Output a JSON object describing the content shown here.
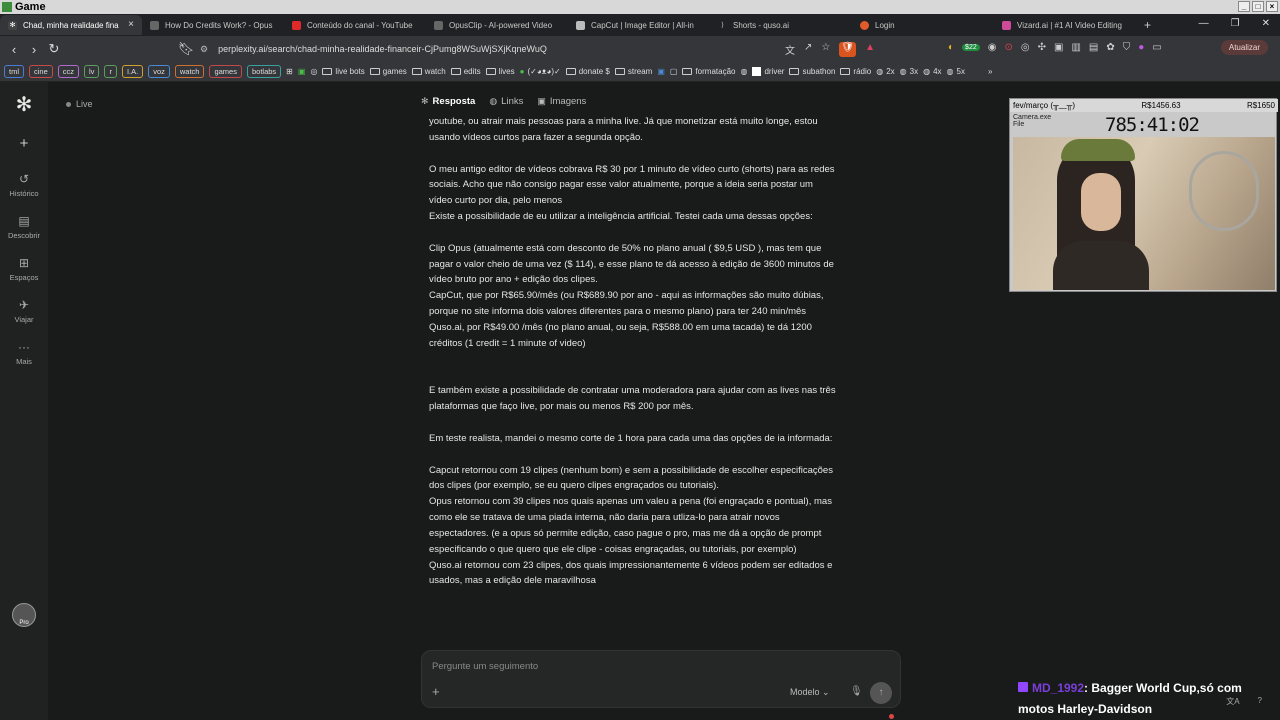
{
  "window": {
    "title": "Game"
  },
  "tabs": [
    {
      "label": "Chad, minha realidade fina",
      "active": true,
      "icon": "perplexity-icon"
    },
    {
      "label": "How Do Credits Work? - Opus",
      "icon": "opus-icon"
    },
    {
      "label": "Conteúdo do canal - YouTube",
      "icon": "youtube-icon"
    },
    {
      "label": "OpusClip - AI-powered Video",
      "icon": "opus-icon"
    },
    {
      "label": "CapCut | Image Editor | All-in",
      "icon": "capcut-icon"
    },
    {
      "label": "Shorts - quso.ai",
      "icon": "quso-icon"
    },
    {
      "label": "Login",
      "icon": "s-icon"
    },
    {
      "label": "Vizard.ai | #1 AI Video Editing",
      "icon": "vizard-icon"
    }
  ],
  "addressbar": {
    "url": "perplexity.ai/search/chad-minha-realidade-financeir-CjPumg8WSuWjSXjKqneWuQ",
    "update_label": "Atualizar",
    "badge": "$22"
  },
  "bookmarks": [
    "tml",
    "cine",
    "ccz",
    "lv",
    "r",
    "I.A.",
    "voz",
    "watch",
    "games",
    "botlabs",
    "live bots",
    "games",
    "watch",
    "edits",
    "lives",
    "(✓◕ᴥ◕)✓",
    "donate $",
    "stream",
    "formatação",
    "driver",
    "subathon",
    "rádio",
    "2x",
    "3x",
    "4x",
    "5x"
  ],
  "sidebar": {
    "items": [
      {
        "label": "Histórico",
        "icon": "history-icon"
      },
      {
        "label": "Descobrir",
        "icon": "discover-icon"
      },
      {
        "label": "Espaços",
        "icon": "spaces-icon"
      },
      {
        "label": "Viajar",
        "icon": "travel-icon"
      },
      {
        "label": "Mais",
        "icon": "more-icon"
      }
    ],
    "avatar_label": "Pro"
  },
  "header": {
    "live_label": "Live",
    "tabs": [
      "Resposta",
      "Links",
      "Imagens"
    ]
  },
  "content": {
    "lines": [
      "youtube, ou atrair mais pessoas para a minha live. Já que monetizar está muito longe, estou",
      "usando vídeos curtos para fazer a segunda opção.",
      "",
      "O meu antigo editor de vídeos cobrava R$ 30 por 1 minuto de vídeo curto (shorts) para as redes",
      "sociais. Acho que não consigo pagar esse valor atualmente, porque a ideia seria postar um",
      "vídeo curto por dia, pelo menos",
      "Existe a possibilidade de eu utilizar a inteligência artificial. Testei cada uma dessas opções:",
      "",
      "Clip Opus (atualmente está com desconto de 50% no plano anual ( $9,5 USD ), mas tem que",
      "pagar o valor cheio de uma vez ($ 114), e esse plano te dá acesso à edição de 3600 minutos de",
      "vídeo bruto por ano + edição dos clipes.",
      "CapCut, que por R$65.90/mês (ou R$689.90 por ano - aqui as informações são muito dúbias,",
      "porque no site informa dois valores diferentes para o mesmo plano) para ter 240 min/mês",
      "Quso.ai, por R$49.00 /mês (no plano anual, ou seja, R$588.00 em uma tacada) te dá 1200",
      "créditos (1 credit = 1 minute of video)",
      "",
      "",
      "E também existe a possibilidade de contratar uma moderadora para ajudar com as lives nas três",
      "plataformas que faço live, por mais ou menos R$ 200 por mês.",
      "",
      "Em teste realista, mandei o mesmo corte de 1 hora para cada uma das opções de ia informada:",
      "",
      "Capcut retornou com 19 clipes (nenhum bom) e sem a possibilidade de escolher especificações",
      "dos clipes (por exemplo, se eu quero clipes engraçados ou tutoriais).",
      "Opus retornou com 39 clipes nos quais apenas um valeu a pena (foi engraçado e pontual), mas",
      "como ele se tratava de uma piada interna, não daria para utliza-lo para atrair novos",
      "espectadores. (e a opus só permite edição, caso pague o pro, mas me dá a opção de prompt",
      "especificando o que quero que ele clipe - coisas engraçadas, ou tutoriais, por exemplo)",
      "Quso.ai retornou com 23 clipes, dos quais impressionantemente 6 vídeos podem ser editados e",
      "usados, mas a edição dele maravilhosa"
    ]
  },
  "followup": {
    "placeholder": "Pergunte um seguimento",
    "model_label": "Modelo"
  },
  "webcam": {
    "header_left": "fev/março (╥﹏╥)",
    "header_mid": "R$1456.63",
    "header_right": "R$1650",
    "timer": "785:41:02",
    "window_label": "Camera.exe",
    "window_menu": "File"
  },
  "overlay": {
    "username": "MD_1992",
    "message": ": Bagger World Cup,só com motos Harley-Davidson"
  }
}
